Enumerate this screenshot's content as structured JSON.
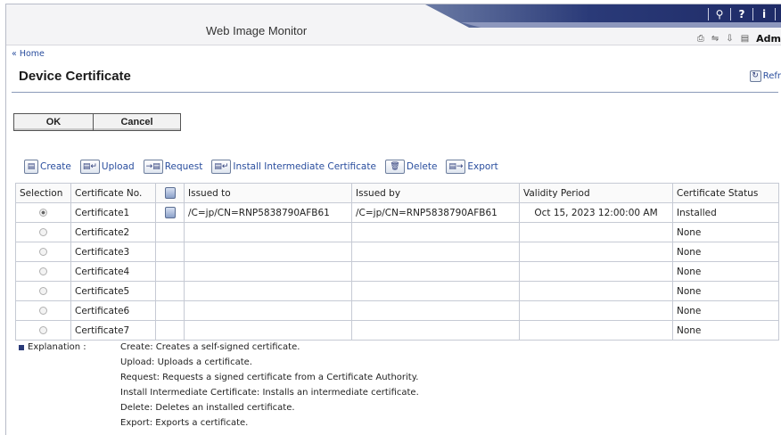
{
  "header": {
    "app_title": "Web Image Monitor",
    "top_icons": [
      "search-icon",
      "help-icon",
      "info-icon"
    ],
    "user_label": "Adm",
    "colors": {
      "brand_dark": "#1e2a66",
      "link": "#2a4e9e"
    }
  },
  "nav": {
    "home_link": "« Home"
  },
  "page": {
    "title": "Device Certificate",
    "refresh_label": "Refr"
  },
  "buttons": {
    "ok": "OK",
    "cancel": "Cancel"
  },
  "toolbar": [
    {
      "label": "Create"
    },
    {
      "label": "Upload"
    },
    {
      "label": "Request"
    },
    {
      "label": "Install Intermediate Certificate"
    },
    {
      "label": "Delete"
    },
    {
      "label": "Export"
    }
  ],
  "table": {
    "headers": [
      "Selection",
      "Certificate No.",
      "",
      "Issued to",
      "Issued by",
      "Validity Period",
      "Certificate Status"
    ],
    "rows": [
      {
        "selected": true,
        "cert_no": "Certificate1",
        "has_detail": true,
        "issued_to": "/C=jp/CN=RNP5838790AFB61",
        "issued_by": "/C=jp/CN=RNP5838790AFB61",
        "validity": "Oct 15, 2023 12:00:00 AM",
        "status": "Installed"
      },
      {
        "selected": false,
        "cert_no": "Certificate2",
        "has_detail": false,
        "issued_to": "",
        "issued_by": "",
        "validity": "",
        "status": "None"
      },
      {
        "selected": false,
        "cert_no": "Certificate3",
        "has_detail": false,
        "issued_to": "",
        "issued_by": "",
        "validity": "",
        "status": "None"
      },
      {
        "selected": false,
        "cert_no": "Certificate4",
        "has_detail": false,
        "issued_to": "",
        "issued_by": "",
        "validity": "",
        "status": "None"
      },
      {
        "selected": false,
        "cert_no": "Certificate5",
        "has_detail": false,
        "issued_to": "",
        "issued_by": "",
        "validity": "",
        "status": "None"
      },
      {
        "selected": false,
        "cert_no": "Certificate6",
        "has_detail": false,
        "issued_to": "",
        "issued_by": "",
        "validity": "",
        "status": "None"
      },
      {
        "selected": false,
        "cert_no": "Certificate7",
        "has_detail": false,
        "issued_to": "",
        "issued_by": "",
        "validity": "",
        "status": "None"
      }
    ]
  },
  "explanation": {
    "label": "Explanation :",
    "lines": [
      "Create: Creates a self-signed certificate.",
      "Upload: Uploads a certificate.",
      "Request: Requests a signed certificate from a Certificate Authority.",
      "Install Intermediate Certificate: Installs an intermediate certificate.",
      "Delete: Deletes an installed certificate.",
      "Export: Exports a certificate."
    ]
  }
}
